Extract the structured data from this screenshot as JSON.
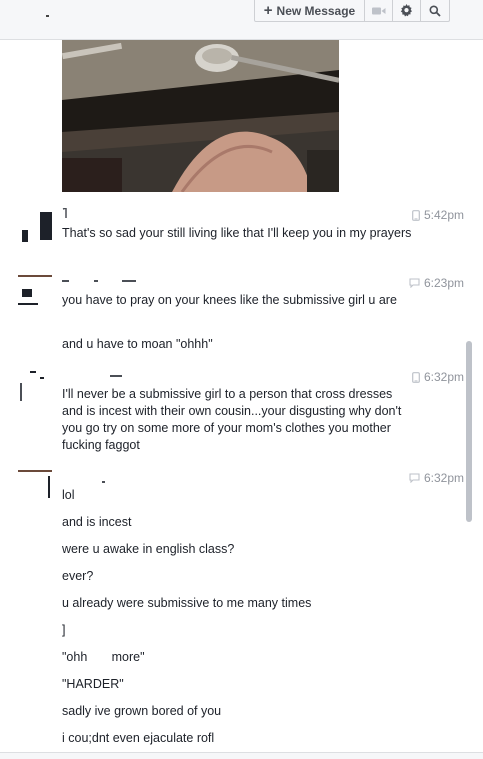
{
  "header": {
    "new_message_label": "New Message",
    "icons": [
      "plus-icon",
      "video-camera-icon",
      "gear-icon",
      "search-icon"
    ]
  },
  "threads": [
    {
      "time": "5:42pm",
      "device": "mobile",
      "messages": [
        "That's so sad your still living like that I'll keep you in my prayers"
      ]
    },
    {
      "time": "6:23pm",
      "device": "chat",
      "messages": [
        "you have to pray on your knees like the submissive girl u are",
        "and u have to moan \"ohhh\""
      ]
    },
    {
      "time": "6:32pm",
      "device": "mobile",
      "messages": [
        "I'll never be a submissive girl to a person that cross dresses and is incest with their own cousin...your disgusting why don't you go try on some more of your mom's clothes you mother fucking faggot"
      ]
    },
    {
      "time": "6:32pm",
      "device": "chat",
      "messages": [
        "lol",
        "and is incest",
        "were u awake in english class?",
        "ever?",
        "u already were submissive to me many times",
        "]",
        "\"ohh       more\"",
        "\"HARDER\"",
        "sadly ive grown bored of you",
        "i cou;dnt even ejaculate rofl"
      ]
    }
  ]
}
